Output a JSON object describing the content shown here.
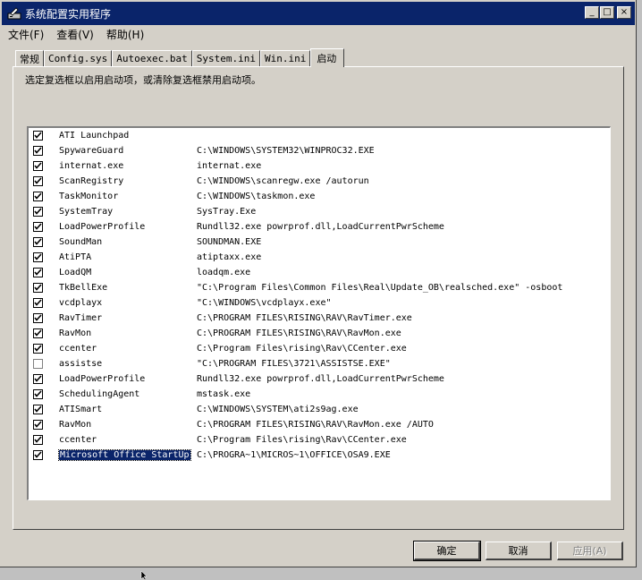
{
  "window": {
    "title": "系统配置实用程序",
    "minimize": "_",
    "maximize": "□",
    "close": "×"
  },
  "menu": [
    "文件(F)",
    "查看(V)",
    "帮助(H)"
  ],
  "tabs": [
    "常规",
    "Config.sys",
    "Autoexec.bat",
    "System.ini",
    "Win.ini",
    "启动"
  ],
  "active_tab": "启动",
  "instruction": "选定复选框以启用启动项，或清除复选框禁用启动项。",
  "items": [
    {
      "name": "ATI Launchpad",
      "command": "",
      "checked": true
    },
    {
      "name": "SpywareGuard",
      "command": "C:\\WINDOWS\\SYSTEM32\\WINPROC32.EXE",
      "checked": true
    },
    {
      "name": "internat.exe",
      "command": "internat.exe",
      "checked": true
    },
    {
      "name": "ScanRegistry",
      "command": "C:\\WINDOWS\\scanregw.exe /autorun",
      "checked": true
    },
    {
      "name": "TaskMonitor",
      "command": "C:\\WINDOWS\\taskmon.exe",
      "checked": true
    },
    {
      "name": "SystemTray",
      "command": "SysTray.Exe",
      "checked": true
    },
    {
      "name": "LoadPowerProfile",
      "command": "Rundll32.exe powrprof.dll,LoadCurrentPwrScheme",
      "checked": true
    },
    {
      "name": "SoundMan",
      "command": "SOUNDMAN.EXE",
      "checked": true
    },
    {
      "name": "AtiPTA",
      "command": "atiptaxx.exe",
      "checked": true
    },
    {
      "name": "LoadQM",
      "command": "loadqm.exe",
      "checked": true
    },
    {
      "name": "TkBellExe",
      "command": "\"C:\\Program Files\\Common Files\\Real\\Update_OB\\realsched.exe\" -osboot",
      "checked": true
    },
    {
      "name": "vcdplayx",
      "command": "\"C:\\WINDOWS\\vcdplayx.exe\"",
      "checked": true
    },
    {
      "name": "RavTimer",
      "command": "C:\\PROGRAM FILES\\RISING\\RAV\\RavTimer.exe",
      "checked": true
    },
    {
      "name": "RavMon",
      "command": "C:\\PROGRAM FILES\\RISING\\RAV\\RavMon.exe",
      "checked": true
    },
    {
      "name": "ccenter",
      "command": "C:\\Program Files\\rising\\Rav\\CCenter.exe",
      "checked": true
    },
    {
      "name": "assistse",
      "command": "\"C:\\PROGRAM FILES\\3721\\ASSISTSE.EXE\"",
      "checked": false
    },
    {
      "name": "LoadPowerProfile",
      "command": "Rundll32.exe powrprof.dll,LoadCurrentPwrScheme",
      "checked": true
    },
    {
      "name": "SchedulingAgent",
      "command": "mstask.exe",
      "checked": true
    },
    {
      "name": "ATISmart",
      "command": "C:\\WINDOWS\\SYSTEM\\ati2s9ag.exe",
      "checked": true
    },
    {
      "name": "RavMon",
      "command": "C:\\PROGRAM FILES\\RISING\\RAV\\RavMon.exe /AUTO",
      "checked": true
    },
    {
      "name": "ccenter",
      "command": "C:\\Program Files\\rising\\Rav\\CCenter.exe",
      "checked": true
    },
    {
      "name": "Microsoft Office StartUp",
      "command": "C:\\PROGRA~1\\MICROS~1\\OFFICE\\OSA9.EXE",
      "checked": true,
      "selected": true
    }
  ],
  "buttons": {
    "ok": "确定",
    "cancel": "取消",
    "apply": "应用(A)"
  },
  "colors": {
    "titlebar": "#0a246a",
    "face": "#d4d0c8",
    "selection": "#0a246a"
  }
}
